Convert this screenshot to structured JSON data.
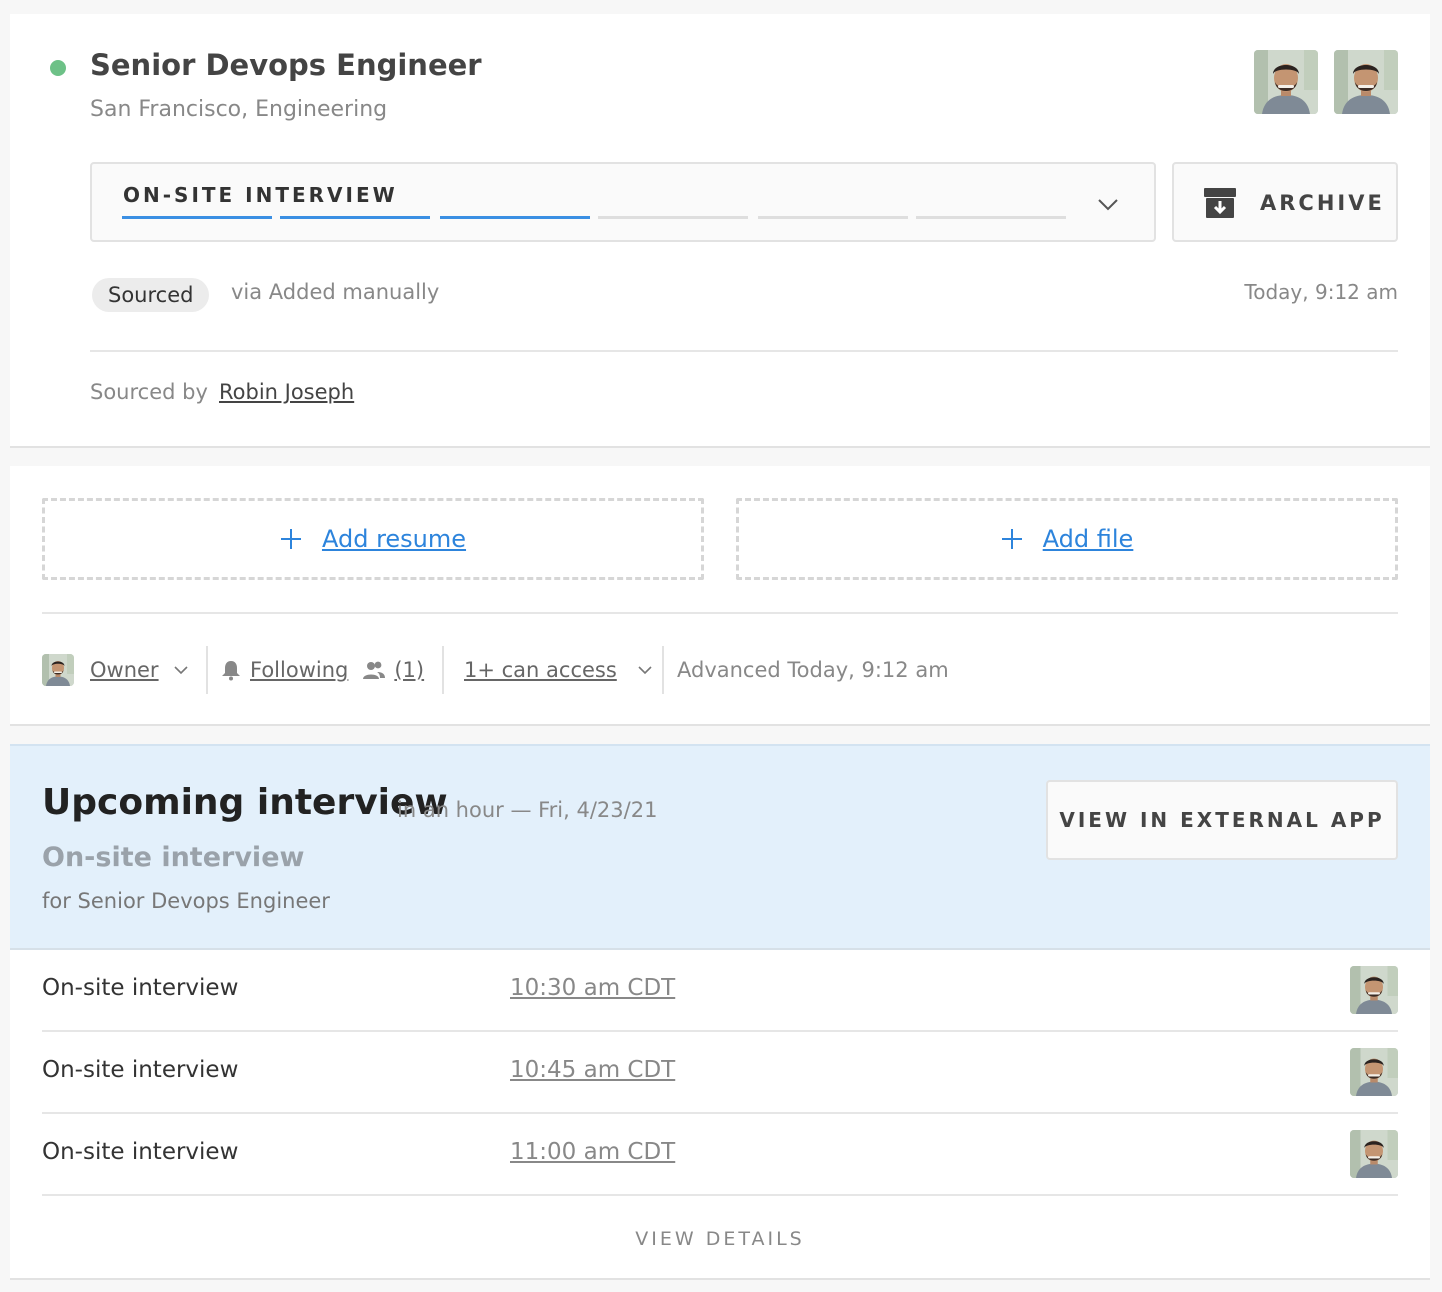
{
  "opportunity": {
    "title": "Senior Devops Engineer",
    "subtitle": "San Francisco, Engineering",
    "status_color": "#6dc187",
    "stage": {
      "label": "ON-SITE INTERVIEW",
      "total_stages": 6,
      "completed_stages": 3,
      "accent": "#3b8fe3"
    },
    "archive_label": "ARCHIVE",
    "badge": "Sourced",
    "origin": "via Added manually",
    "timestamp": "Today, 9:12 am",
    "sourced_by_label": "Sourced by",
    "sourced_by_name": "Robin Joseph",
    "avatars": [
      "avatar",
      "avatar"
    ]
  },
  "files": {
    "add_resume": "Add resume",
    "add_file": "Add file"
  },
  "meta": {
    "owner_label": "Owner",
    "following_label": "Following",
    "followers_count": "(1)",
    "access_label": "1+ can access",
    "advanced_text": "Advanced Today, 9:12 am"
  },
  "interview": {
    "title": "Upcoming interview",
    "when": "in an hour — Fri, 4/23/21",
    "subtitle": "On-site interview",
    "for_text": "for Senior Devops Engineer",
    "external_button": "VIEW IN EXTERNAL APP",
    "rows": [
      {
        "name": "On-site interview",
        "time": "10:30 am CDT"
      },
      {
        "name": "On-site interview",
        "time": "10:45 am CDT"
      },
      {
        "name": "On-site interview",
        "time": "11:00 am CDT"
      }
    ],
    "view_details": "VIEW DETAILS"
  }
}
